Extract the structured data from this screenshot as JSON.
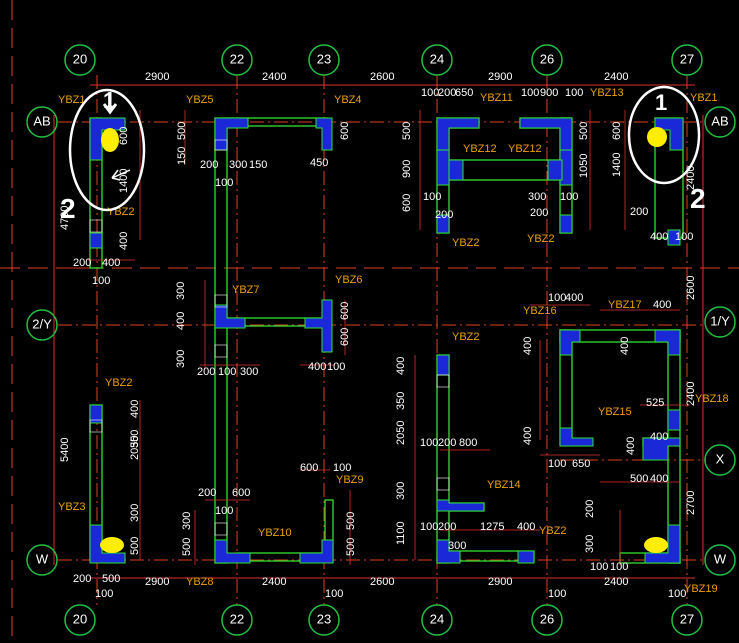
{
  "colors": {
    "background": "#000000",
    "grid_line": "#e04020",
    "bubble": "#20c040",
    "wall_outline": "#30e030",
    "column_fill": "#1a28d8",
    "dimension_line": "#e03030",
    "text": "#ffffff",
    "tag_text": "#e8a000",
    "highlight": "#ffee00",
    "annotation": "#ffffff"
  },
  "axes": {
    "top": [
      "20",
      "22",
      "23",
      "24",
      "26",
      "27"
    ],
    "bottom": [
      "20",
      "22",
      "23",
      "24",
      "26",
      "27"
    ],
    "left": [
      "AB",
      "2/Y",
      "W"
    ],
    "right": [
      "AB",
      "1/Y",
      "X",
      "W"
    ]
  },
  "spans": {
    "top": [
      "2900",
      "2400",
      "2600",
      "2900",
      "2400"
    ],
    "bottom": [
      "2900",
      "2400",
      "2600",
      "2900",
      "2400"
    ]
  },
  "left_dims": [
    "4700",
    "5400"
  ],
  "right_dims": [
    "2400",
    "2600",
    "2400",
    "2700"
  ],
  "column_tags": {
    "ybz1_left": "YBZ1",
    "ybz5": "YBZ5",
    "ybz4": "YBZ4",
    "ybz11": "YBZ11",
    "ybz13": "YBZ13",
    "ybz1_right": "YBZ1",
    "ybz12_a": "YBZ12",
    "ybz12_b": "YBZ12",
    "ybz2_top_left": "YBZ2",
    "ybz2_mid_a": "YBZ2",
    "ybz2_mid_b": "YBZ2",
    "ybz7": "YBZ7",
    "ybz6": "YBZ6",
    "ybz16": "YBZ16",
    "ybz17": "YBZ17",
    "ybz2_center": "YBZ2",
    "ybz2_lower_left": "YBZ2",
    "ybz18": "YBZ18",
    "ybz15": "YBZ15",
    "ybz14": "YBZ14",
    "ybz9": "YBZ9",
    "ybz3": "YBZ3",
    "ybz10": "YBZ10",
    "ybz2_bottom": "YBZ2",
    "ybz8": "YBZ8",
    "ybz19": "YBZ19"
  },
  "small_dims": {
    "d100": "100",
    "d200": "200",
    "d300": "300",
    "d400": "400",
    "d500": "500",
    "d600": "600",
    "d650": "650",
    "d900": "900",
    "d150": "150",
    "d450": "450",
    "d1400": "1400",
    "d1050": "1050",
    "d2050": "2050",
    "d350": "350",
    "d800": "800",
    "d1275": "1275",
    "d525": "525",
    "d1100": "1100"
  },
  "annotations": {
    "left_mark_top": "1",
    "left_mark_bottom": "2",
    "right_mark_top": "1",
    "right_mark_bottom": "2"
  }
}
